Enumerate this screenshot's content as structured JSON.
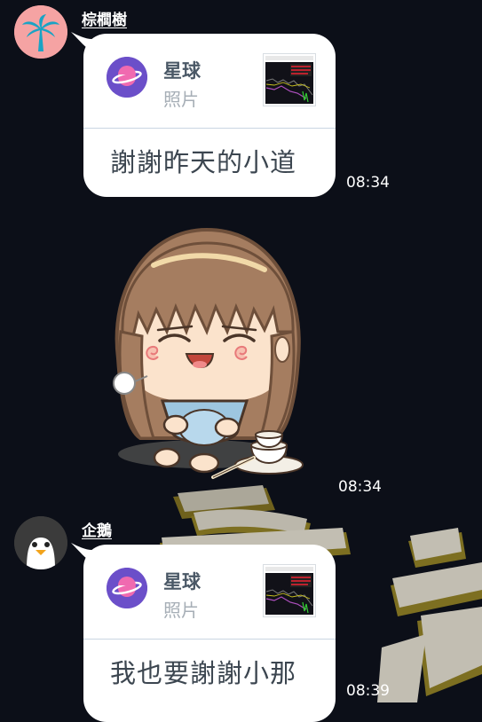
{
  "chat": {
    "messages": [
      {
        "sender": "棕櫚樹",
        "avatar_icon": "palm-tree-icon",
        "share_app_name": "星球",
        "share_type": "照片",
        "text": "謝謝昨天的小道",
        "time": "08:34"
      },
      {
        "sticker": "girl-full-belly-sticker",
        "time": "08:34"
      },
      {
        "sender": "企鵝",
        "avatar_icon": "penguin-icon",
        "share_app_name": "星球",
        "share_type": "照片",
        "text": "我也要謝謝小那",
        "time": "08:39"
      }
    ]
  },
  "colors": {
    "background": "#0c0f18",
    "bubble": "#ffffff",
    "app_icon": "#6b4fc9",
    "palm_avatar_bg": "#f5a3a3",
    "palm_leaf": "#1aa3c4"
  }
}
